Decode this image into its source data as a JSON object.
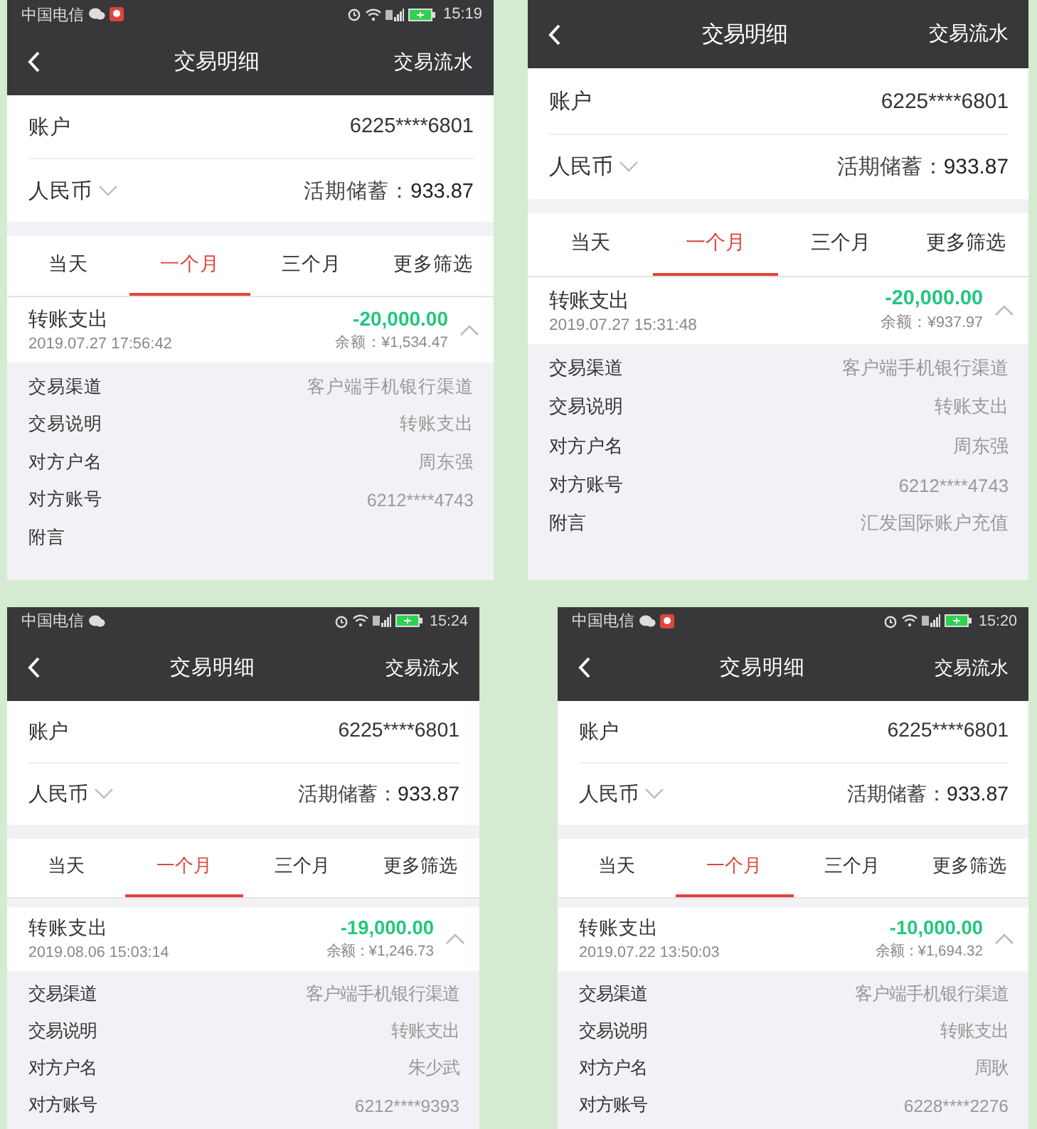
{
  "screens": [
    {
      "status_bar": {
        "carrier": "中国电信",
        "notification_icons": [
          {
            "kind": "chat"
          },
          {
            "kind": "app"
          }
        ],
        "time": "15:19"
      },
      "header": {
        "title": "交易明细",
        "action": "交易流水"
      },
      "account": {
        "label": "账户",
        "value": "6225****6801"
      },
      "currency": {
        "label": "人民币",
        "balance_label": "活期储蓄：",
        "balance": "933.87"
      },
      "tabs": [
        {
          "label": "当天",
          "selected": false
        },
        {
          "label": "一个月",
          "selected": true
        },
        {
          "label": "三个月",
          "selected": false
        },
        {
          "label": "更多筛选",
          "selected": false
        }
      ],
      "transaction": {
        "title": "转账支出",
        "datetime": "2019.07.27 17:56:42",
        "amount": "-20,000.00",
        "balance": "余额：¥1,534.47",
        "expanded": true
      },
      "details": [
        {
          "label": "交易渠道",
          "value": "客户端手机银行渠道"
        },
        {
          "label": "交易说明",
          "value": "转账支出"
        },
        {
          "label": "对方户名",
          "value": "周东强"
        },
        {
          "label": "对方账号",
          "value": "6212****4743"
        },
        {
          "label": "附言"
        }
      ]
    },
    {
      "header": {
        "title": "交易明细",
        "action": "交易流水"
      },
      "account": {
        "label": "账户",
        "value": "6225****6801"
      },
      "currency": {
        "label": "人民币",
        "balance_label": "活期储蓄：",
        "balance": "933.87"
      },
      "tabs": [
        {
          "label": "当天",
          "selected": false
        },
        {
          "label": "一个月",
          "selected": true
        },
        {
          "label": "三个月",
          "selected": false
        },
        {
          "label": "更多筛选",
          "selected": false
        }
      ],
      "transaction": {
        "title": "转账支出",
        "datetime": "2019.07.27 15:31:48",
        "amount": "-20,000.00",
        "balance": "余额：¥937.97",
        "expanded": true
      },
      "details": [
        {
          "label": "交易渠道",
          "value": "客户端手机银行渠道"
        },
        {
          "label": "交易说明",
          "value": "转账支出"
        },
        {
          "label": "对方户名",
          "value": "周东强"
        },
        {
          "label": "对方账号",
          "value": "6212****4743"
        },
        {
          "label": "附言",
          "value": "汇发国际账户充值"
        }
      ]
    },
    {
      "status_bar": {
        "carrier": "中国电信",
        "notification_icons": [
          {
            "kind": "chat"
          }
        ],
        "time": "15:24"
      },
      "header": {
        "title": "交易明细",
        "action": "交易流水"
      },
      "account": {
        "label": "账户",
        "value": "6225****6801"
      },
      "currency": {
        "label": "人民币",
        "balance_label": "活期储蓄：",
        "balance": "933.87"
      },
      "tabs": [
        {
          "label": "当天",
          "selected": false
        },
        {
          "label": "一个月",
          "selected": true
        },
        {
          "label": "三个月",
          "selected": false
        },
        {
          "label": "更多筛选",
          "selected": false
        }
      ],
      "transaction": {
        "title": "转账支出",
        "datetime": "2019.08.06 15:03:14",
        "amount": "-19,000.00",
        "balance": "余额：¥1,246.73",
        "expanded": true
      },
      "details": [
        {
          "label": "交易渠道",
          "value": "客户端手机银行渠道"
        },
        {
          "label": "交易说明",
          "value": "转账支出"
        },
        {
          "label": "对方户名",
          "value": "朱少武"
        },
        {
          "label": "对方账号",
          "value": "6212****9393"
        }
      ]
    },
    {
      "status_bar": {
        "carrier": "中国电信",
        "notification_icons": [
          {
            "kind": "chat"
          },
          {
            "kind": "app"
          }
        ],
        "time": "15:20"
      },
      "header": {
        "title": "交易明细",
        "action": "交易流水"
      },
      "account": {
        "label": "账户",
        "value": "6225****6801"
      },
      "currency": {
        "label": "人民币",
        "balance_label": "活期储蓄：",
        "balance": "933.87"
      },
      "tabs": [
        {
          "label": "当天",
          "selected": false
        },
        {
          "label": "一个月",
          "selected": true
        },
        {
          "label": "三个月",
          "selected": false
        },
        {
          "label": "更多筛选",
          "selected": false
        }
      ],
      "transaction": {
        "title": "转账支出",
        "datetime": "2019.07.22 13:50:03",
        "amount": "-10,000.00",
        "balance": "余额：¥1,694.32",
        "expanded": true
      },
      "details": [
        {
          "label": "交易渠道",
          "value": "客户端手机银行渠道"
        },
        {
          "label": "交易说明",
          "value": "转账支出"
        },
        {
          "label": "对方户名",
          "value": "周耿"
        },
        {
          "label": "对方账号",
          "value": "6228****2276"
        }
      ]
    }
  ]
}
